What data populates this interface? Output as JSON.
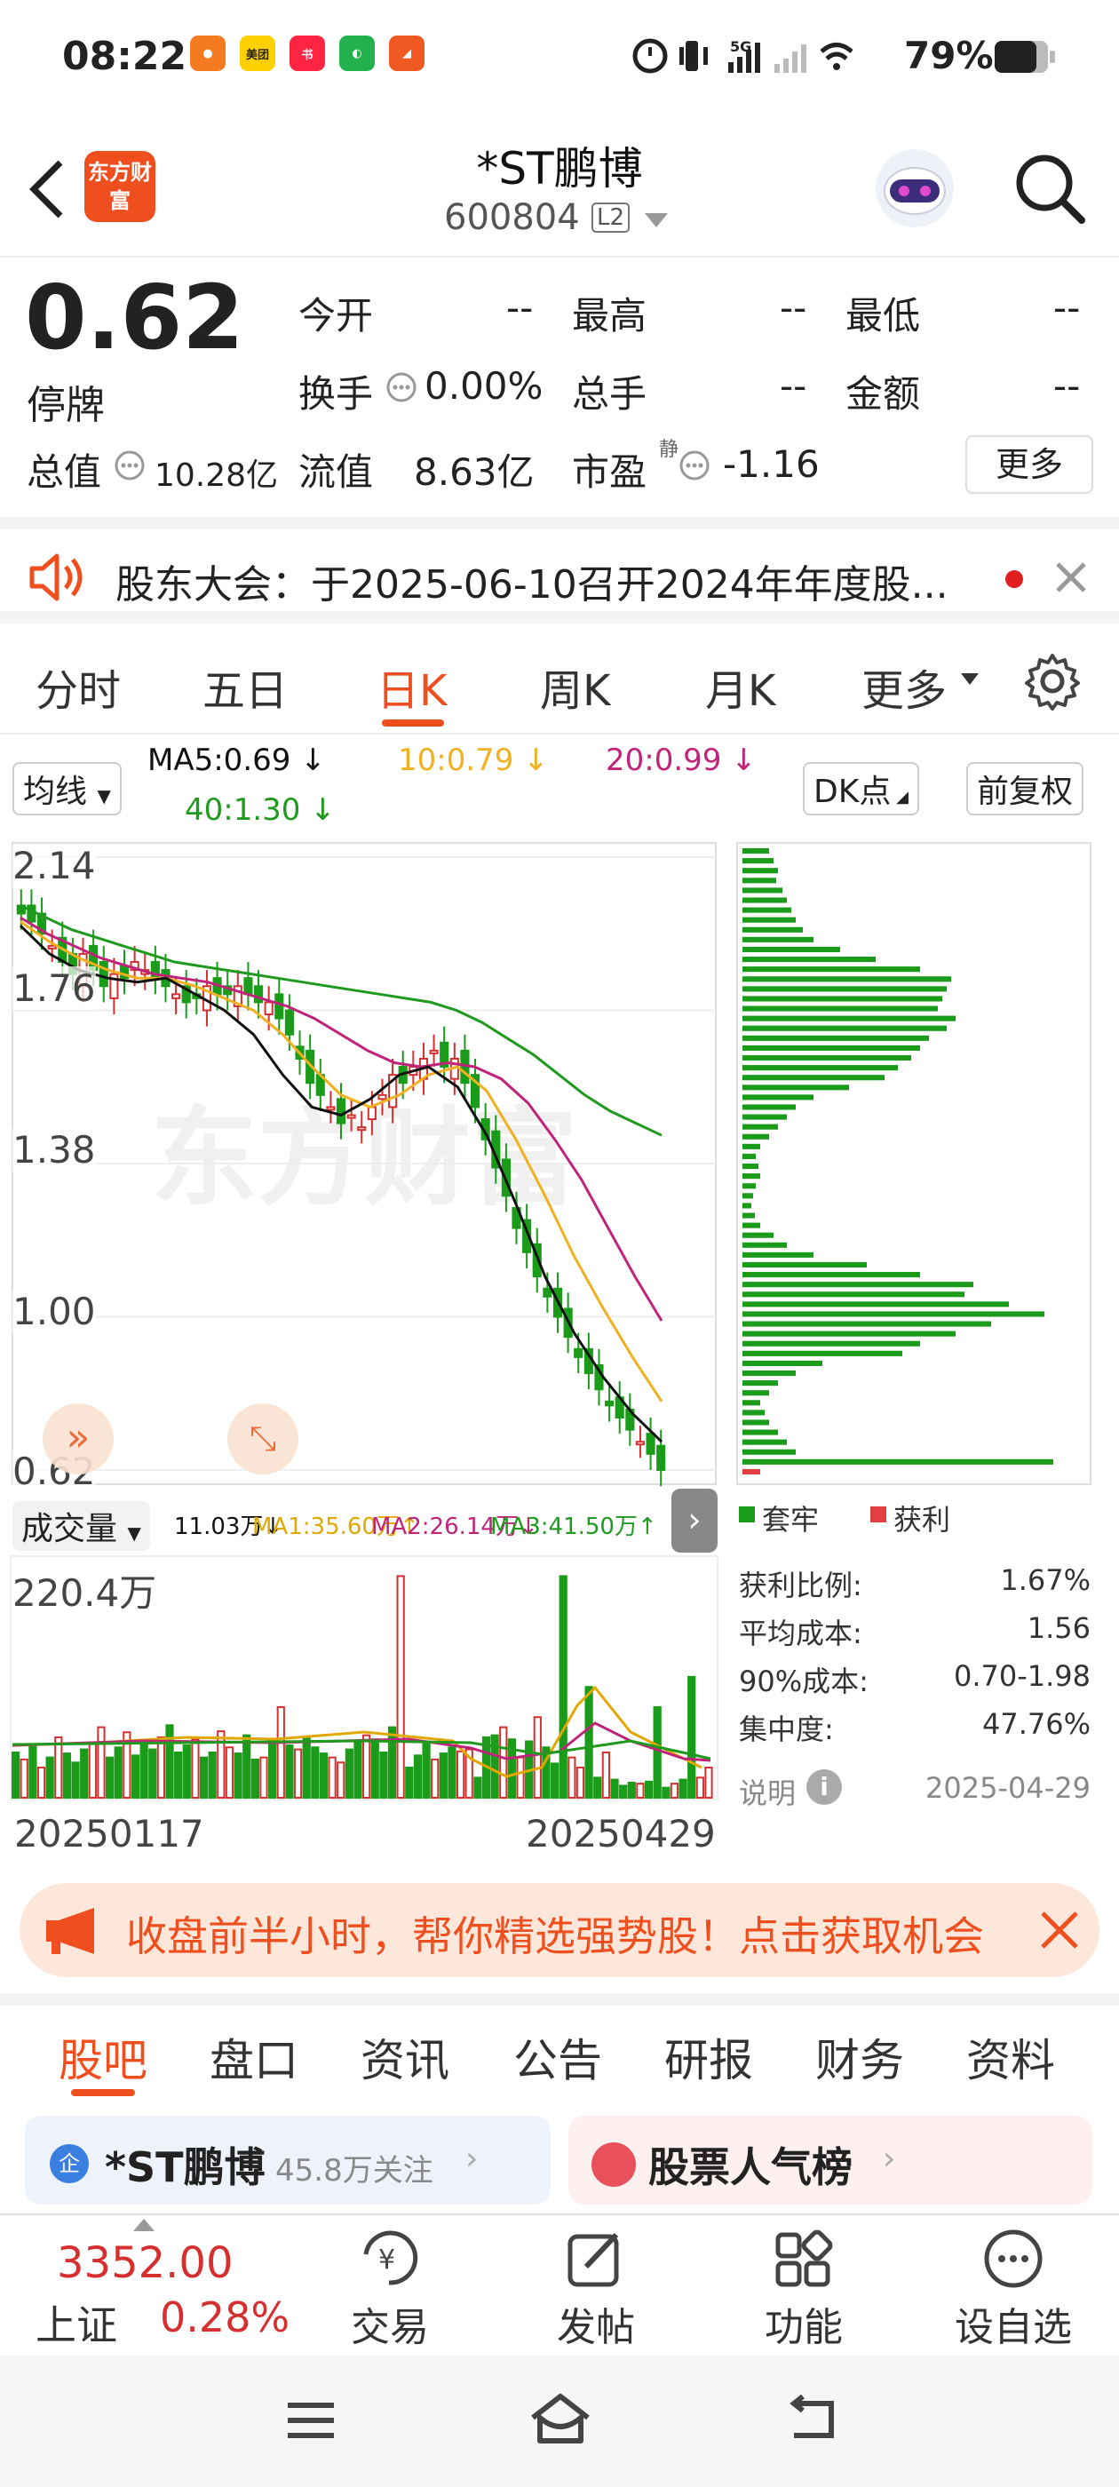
{
  "status_bar": {
    "time": "08:22",
    "battery": "79%",
    "network": "5G"
  },
  "header": {
    "title": "*ST鹏博",
    "code": "600804",
    "level": "L2",
    "logo_text": "东方财富"
  },
  "quote": {
    "price": "0.62",
    "state": "停牌",
    "fields": {
      "open_label": "今开",
      "open": "--",
      "high_label": "最高",
      "high": "--",
      "low_label": "最低",
      "low": "--",
      "turnover_label": "换手",
      "turnover": "0.00%",
      "volume_label": "总手",
      "volume": "--",
      "amount_label": "金额",
      "amount": "--",
      "mktcap_label": "总值",
      "mktcap": "10.28亿",
      "float_label": "流值",
      "float": "8.63亿",
      "pe_label": "市盈",
      "pe_sup": "静",
      "pe": "-1.16"
    },
    "more_label": "更多"
  },
  "notice": {
    "text": "股东大会：于2025-06-10召开2024年年度股..."
  },
  "period_tabs": [
    "分时",
    "五日",
    "日K",
    "周K",
    "月K",
    "更多"
  ],
  "period_active": "日K",
  "ma_bar": {
    "selector": "均线",
    "ma5": "MA5:0.69",
    "ma10": "10:0.79",
    "ma20": "20:0.99",
    "ma40": "40:1.30",
    "dk": "DK点",
    "adjust": "前复权"
  },
  "price_axis": [
    "2.14",
    "1.76",
    "1.38",
    "1.00",
    "0.62"
  ],
  "watermark": "东方财富",
  "volume_bar": {
    "selector": "成交量",
    "vol": "11.03万",
    "ma1": "MA1:35.60万",
    "ma2": "MA2:26.14万",
    "ma3": "MA3:41.50万",
    "max": "220.4万"
  },
  "dates": {
    "start": "20250117",
    "end": "20250429"
  },
  "chips": {
    "legend_trapped": "套牢",
    "legend_profit": "获利",
    "rows": [
      {
        "label": "获利比例:",
        "value": "1.67%"
      },
      {
        "label": "平均成本:",
        "value": "1.56"
      },
      {
        "label": "90%成本:",
        "value": "0.70-1.98"
      },
      {
        "label": "集中度:",
        "value": "47.76%"
      }
    ],
    "note_label": "说明",
    "date": "2025-04-29"
  },
  "ad": {
    "text": "收盘前半小时，帮你精选强势股！点击获取机会"
  },
  "bottom_tabs": [
    "股吧",
    "盘口",
    "资讯",
    "公告",
    "研报",
    "财务",
    "资料"
  ],
  "bottom_tab_active": "股吧",
  "cards": {
    "left_title": "*ST鹏博",
    "left_sub": "45.8万关注",
    "right_title": "股票人气榜"
  },
  "bottom_nav": {
    "index_value": "3352.00",
    "index_name": "上证",
    "index_change": "0.28%",
    "items": [
      "交易",
      "发帖",
      "功能",
      "设自选"
    ]
  },
  "colors": {
    "accent": "#ef4f1f",
    "up": "#d62f2f",
    "down": "#1a9c1a",
    "ma5": "#111111",
    "ma10": "#f0b020",
    "ma20": "#c0247a",
    "ma40": "#1f9a1f"
  },
  "chart_data": {
    "type": "candlestick",
    "title": "",
    "x_start": "20250117",
    "x_end": "20250429",
    "ylim": [
      0.62,
      2.14
    ],
    "y_ticks": [
      2.14,
      1.76,
      1.38,
      1.0,
      0.62
    ],
    "series": [
      {
        "name": "MA5",
        "last": 0.69
      },
      {
        "name": "MA10",
        "last": 0.79
      },
      {
        "name": "MA20",
        "last": 0.99
      },
      {
        "name": "MA40",
        "last": 1.3
      }
    ],
    "close_series": [
      2.0,
      1.98,
      1.95,
      1.92,
      1.88,
      1.85,
      1.9,
      1.86,
      1.82,
      1.85,
      1.84,
      1.88,
      1.86,
      1.84,
      1.82,
      1.8,
      1.78,
      1.79,
      1.82,
      1.8,
      1.8,
      1.82,
      1.8,
      1.78,
      1.78,
      1.74,
      1.7,
      1.64,
      1.58,
      1.55,
      1.52,
      1.48,
      1.5,
      1.47,
      1.52,
      1.55,
      1.6,
      1.58,
      1.62,
      1.64,
      1.66,
      1.62,
      1.64,
      1.58,
      1.52,
      1.44,
      1.37,
      1.3,
      1.22,
      1.16,
      1.1,
      1.05,
      1.0,
      0.95,
      0.9,
      0.86,
      0.82,
      0.78,
      0.75,
      0.72,
      0.69,
      0.66,
      0.62
    ],
    "ma_paths": {
      "ma40": [
        2.02,
        1.99,
        1.96,
        1.94,
        1.92,
        1.9,
        1.88,
        1.87,
        1.86,
        1.85,
        1.84,
        1.83,
        1.82,
        1.81,
        1.8,
        1.79,
        1.78,
        1.76,
        1.73,
        1.69,
        1.65,
        1.6,
        1.55,
        1.51,
        1.48,
        1.45
      ],
      "ma20": [
        1.99,
        1.95,
        1.92,
        1.89,
        1.87,
        1.85,
        1.84,
        1.83,
        1.81,
        1.79,
        1.77,
        1.74,
        1.7,
        1.66,
        1.63,
        1.62,
        1.63,
        1.62,
        1.59,
        1.53,
        1.44,
        1.34,
        1.22,
        1.1,
        0.99
      ],
      "ma10": [
        1.98,
        1.93,
        1.89,
        1.86,
        1.84,
        1.84,
        1.82,
        1.79,
        1.76,
        1.7,
        1.62,
        1.55,
        1.52,
        1.55,
        1.6,
        1.62,
        1.56,
        1.44,
        1.3,
        1.15,
        1.02,
        0.9,
        0.79
      ],
      "ma5": [
        1.97,
        1.9,
        1.86,
        1.84,
        1.83,
        1.84,
        1.8,
        1.76,
        1.7,
        1.6,
        1.52,
        1.5,
        1.54,
        1.6,
        1.62,
        1.57,
        1.45,
        1.28,
        1.1,
        0.96,
        0.85,
        0.76,
        0.69
      ]
    },
    "volume_max": 220.4,
    "volume_unit": "万"
  }
}
